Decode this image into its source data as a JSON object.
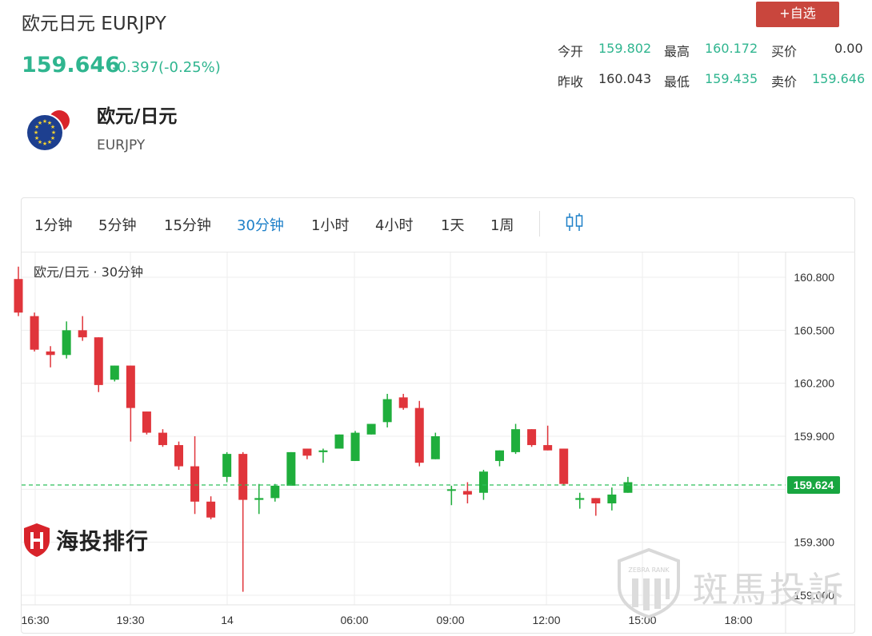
{
  "header": {
    "title": "欧元日元 EURJPY",
    "add_button": "+自选",
    "price": "159.646",
    "change": "-0.397(-0.25%)"
  },
  "quote": {
    "open_label": "今开",
    "open": "159.802",
    "high_label": "最高",
    "high": "160.172",
    "bid_label": "买价",
    "bid": "0.00",
    "prev_label": "昨收",
    "prev": "160.043",
    "low_label": "最低",
    "low": "159.435",
    "ask_label": "卖价",
    "ask": "159.646"
  },
  "pair": {
    "name": "欧元/日元",
    "code": "EURJPY"
  },
  "tabs": [
    "1分钟",
    "5分钟",
    "15分钟",
    "30分钟",
    "1小时",
    "4小时",
    "1天",
    "1周"
  ],
  "active_tab": "30分钟",
  "watermarks": {
    "left": "海投排行",
    "right": "斑馬投訴",
    "badge": "ZEBRA RANK"
  },
  "colors": {
    "up": "#1fae3c",
    "down": "#e0353b",
    "accent": "#2fb58f",
    "active_tab": "#1e80c8",
    "button": "#c9463d"
  },
  "chart_data": {
    "type": "candlestick",
    "title": "欧元/日元 · 30分钟",
    "y_ticks": [
      "160.800",
      "160.500",
      "160.200",
      "159.900",
      "159.600",
      "159.300",
      "159.000"
    ],
    "ylim": [
      158.98,
      160.86
    ],
    "x_ticks": [
      "16:30",
      "19:30",
      "14",
      "06:00",
      "09:00",
      "12:00",
      "15:00",
      "18:00"
    ],
    "current_price": "159.624",
    "candles": [
      {
        "o": 160.79,
        "h": 160.86,
        "l": 160.58,
        "c": 160.6
      },
      {
        "o": 160.58,
        "h": 160.6,
        "l": 160.38,
        "c": 160.39
      },
      {
        "o": 160.38,
        "h": 160.41,
        "l": 160.29,
        "c": 160.36
      },
      {
        "o": 160.36,
        "h": 160.55,
        "l": 160.34,
        "c": 160.5
      },
      {
        "o": 160.5,
        "h": 160.58,
        "l": 160.44,
        "c": 160.46
      },
      {
        "o": 160.46,
        "h": 160.46,
        "l": 160.15,
        "c": 160.19
      },
      {
        "o": 160.22,
        "h": 160.3,
        "l": 160.21,
        "c": 160.3
      },
      {
        "o": 160.3,
        "h": 160.3,
        "l": 159.87,
        "c": 160.06
      },
      {
        "o": 160.04,
        "h": 160.04,
        "l": 159.91,
        "c": 159.92
      },
      {
        "o": 159.92,
        "h": 159.94,
        "l": 159.84,
        "c": 159.85
      },
      {
        "o": 159.85,
        "h": 159.87,
        "l": 159.71,
        "c": 159.73
      },
      {
        "o": 159.73,
        "h": 159.9,
        "l": 159.46,
        "c": 159.53
      },
      {
        "o": 159.53,
        "h": 159.56,
        "l": 159.43,
        "c": 159.44
      },
      {
        "o": 159.67,
        "h": 159.81,
        "l": 159.64,
        "c": 159.8
      },
      {
        "o": 159.8,
        "h": 159.81,
        "l": 159.02,
        "c": 159.54
      },
      {
        "o": 159.54,
        "h": 159.63,
        "l": 159.46,
        "c": 159.55
      },
      {
        "o": 159.55,
        "h": 159.63,
        "l": 159.53,
        "c": 159.62
      },
      {
        "o": 159.62,
        "h": 159.81,
        "l": 159.62,
        "c": 159.81
      },
      {
        "o": 159.83,
        "h": 159.83,
        "l": 159.77,
        "c": 159.79
      },
      {
        "o": 159.81,
        "h": 159.83,
        "l": 159.75,
        "c": 159.82
      },
      {
        "o": 159.83,
        "h": 159.91,
        "l": 159.83,
        "c": 159.91
      },
      {
        "o": 159.76,
        "h": 159.93,
        "l": 159.76,
        "c": 159.92
      },
      {
        "o": 159.91,
        "h": 159.97,
        "l": 159.91,
        "c": 159.97
      },
      {
        "o": 159.98,
        "h": 160.14,
        "l": 159.95,
        "c": 160.11
      },
      {
        "o": 160.12,
        "h": 160.14,
        "l": 160.05,
        "c": 160.06
      },
      {
        "o": 160.06,
        "h": 160.1,
        "l": 159.73,
        "c": 159.75
      },
      {
        "o": 159.77,
        "h": 159.92,
        "l": 159.77,
        "c": 159.9
      },
      {
        "o": 159.6,
        "h": 159.62,
        "l": 159.51,
        "c": 159.6
      },
      {
        "o": 159.59,
        "h": 159.64,
        "l": 159.52,
        "c": 159.57
      },
      {
        "o": 159.58,
        "h": 159.71,
        "l": 159.54,
        "c": 159.7
      },
      {
        "o": 159.76,
        "h": 159.82,
        "l": 159.73,
        "c": 159.82
      },
      {
        "o": 159.81,
        "h": 159.97,
        "l": 159.8,
        "c": 159.94
      },
      {
        "o": 159.94,
        "h": 159.94,
        "l": 159.84,
        "c": 159.85
      },
      {
        "o": 159.85,
        "h": 159.96,
        "l": 159.82,
        "c": 159.82
      },
      {
        "o": 159.83,
        "h": 159.83,
        "l": 159.62,
        "c": 159.63
      },
      {
        "o": 159.54,
        "h": 159.58,
        "l": 159.49,
        "c": 159.55
      },
      {
        "o": 159.55,
        "h": 159.55,
        "l": 159.45,
        "c": 159.52
      },
      {
        "o": 159.52,
        "h": 159.61,
        "l": 159.48,
        "c": 159.57
      },
      {
        "o": 159.58,
        "h": 159.67,
        "l": 159.58,
        "c": 159.64
      }
    ]
  }
}
